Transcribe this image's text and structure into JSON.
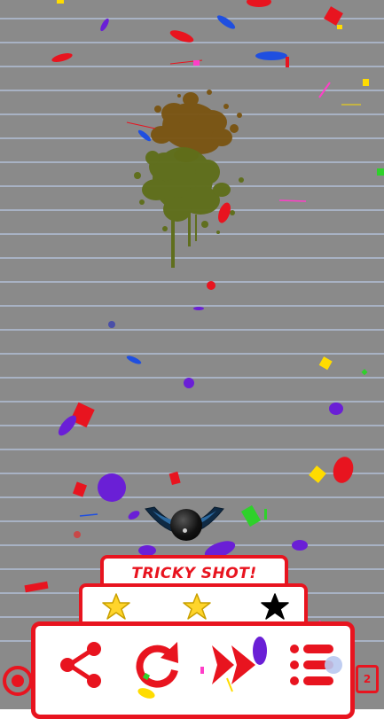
{
  "result": {
    "message": "TRICKY SHOT!",
    "stars_earned": 2,
    "stars_total": 3
  },
  "actions": {
    "share": "share-icon",
    "retry": "retry-icon",
    "next": "fast-forward-icon",
    "menu": "menu-icon"
  },
  "corner_label_right": "2",
  "colors": {
    "accent": "#e8141f",
    "star_earned": "#ffd52b",
    "star_empty": "#000000",
    "background": "#8a8a8a"
  }
}
